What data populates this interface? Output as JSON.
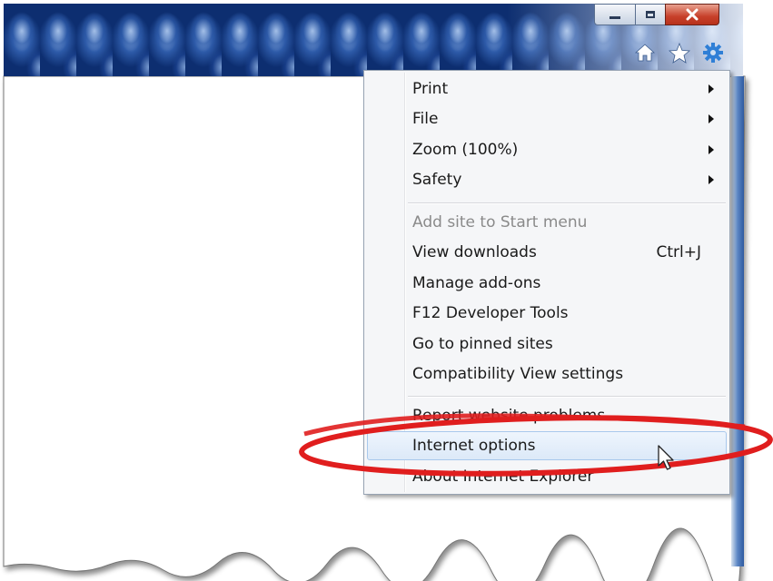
{
  "toolbar": {
    "icons": [
      "home-icon",
      "star-icon",
      "gear-icon"
    ],
    "gear_color": "#2f7fd6"
  },
  "menu": {
    "group1": [
      {
        "label": "Print",
        "submenu": true
      },
      {
        "label": "File",
        "submenu": true
      },
      {
        "label": "Zoom (100%)",
        "submenu": true
      },
      {
        "label": "Safety",
        "submenu": true
      }
    ],
    "group2": [
      {
        "label": "Add site to Start menu",
        "disabled": true
      },
      {
        "label": "View downloads",
        "shortcut": "Ctrl+J"
      },
      {
        "label": "Manage add-ons"
      },
      {
        "label": "F12 Developer Tools"
      },
      {
        "label": "Go to pinned sites"
      },
      {
        "label": "Compatibility View settings"
      }
    ],
    "group3": [
      {
        "label": "Report website problems"
      },
      {
        "label": "Internet options",
        "highlighted": true
      },
      {
        "label": "About Internet Explorer"
      }
    ]
  },
  "colors": {
    "highlight_ellipse": "#e01e1e",
    "close_button": "#c7402a"
  }
}
